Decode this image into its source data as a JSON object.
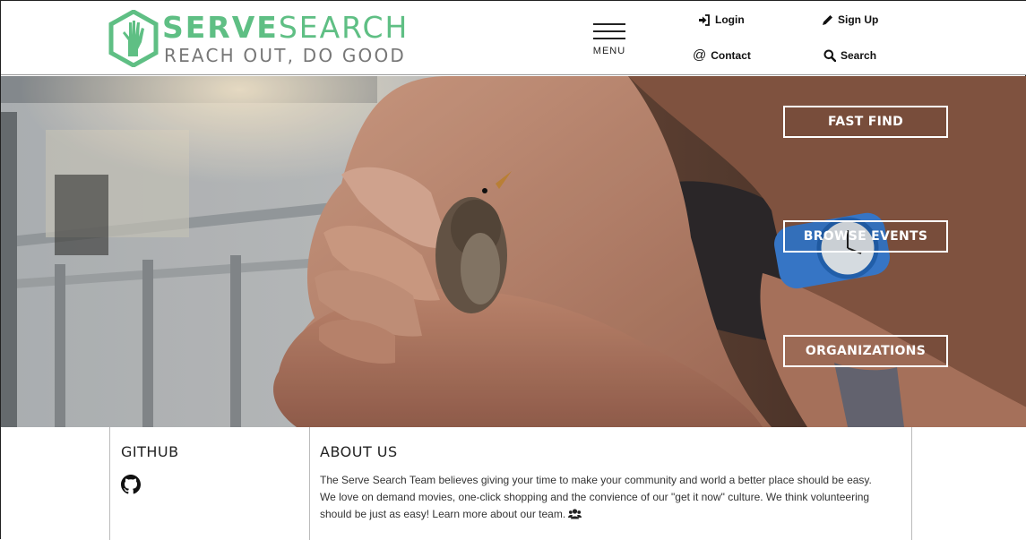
{
  "brand": {
    "name_part1": "SERVE",
    "name_part2": "SEARCH",
    "tagline": "REACH OUT, DO GOOD",
    "accent_color": "#5fbf84",
    "logo_icon": "raised-hand-hexagon-icon"
  },
  "header": {
    "menu_label": "MENU",
    "links": {
      "login": {
        "label": "Login",
        "icon": "login-icon"
      },
      "signup": {
        "label": "Sign Up",
        "icon": "pencil-icon"
      },
      "contact": {
        "label": "Contact",
        "icon": "at-icon"
      },
      "search": {
        "label": "Search",
        "icon": "search-icon"
      }
    }
  },
  "hero": {
    "buttons": {
      "fast_find": "FAST FIND",
      "browse_events": "BROWSE EVENTS",
      "organizations": "ORGANIZATIONS"
    }
  },
  "footer": {
    "github_title": "GITHUB",
    "github_icon": "github-icon",
    "about_title": "ABOUT US",
    "about_text": "The Serve Search Team believes giving your time to make your community and world a better place should be easy. We love on demand movies, one-click shopping and the convience of our \"get it now\" culture. We think volunteering should be just as easy! Learn more about our team.",
    "team_icon": "users-icon"
  }
}
